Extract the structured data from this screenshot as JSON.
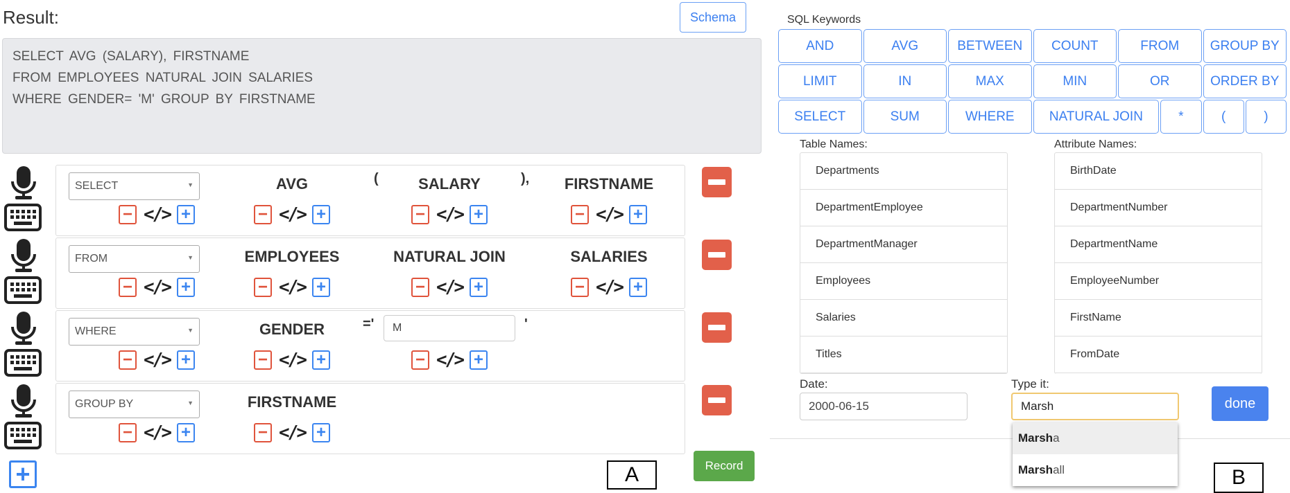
{
  "panel_a": {
    "result_label": "Result:",
    "schema_button": "Schema",
    "result_lines": [
      "SELECT  AVG  (SALARY),  FIRSTNAME",
      "FROM  EMPLOYEES  NATURAL JOIN  SALARIES",
      "WHERE  GENDER=  'M'  GROUP BY  FIRSTNAME"
    ],
    "rows": [
      {
        "clause": "SELECT",
        "tokens": [
          "AVG",
          "SALARY",
          "FIRSTNAME"
        ],
        "punct": [
          "(",
          "),"
        ]
      },
      {
        "clause": "FROM",
        "tokens": [
          "EMPLOYEES",
          "NATURAL JOIN",
          "SALARIES"
        ]
      },
      {
        "clause": "WHERE",
        "tokens": [
          "GENDER"
        ],
        "operator": "='",
        "value": "M",
        "close": "'"
      },
      {
        "clause": "GROUP BY",
        "tokens": [
          "FIRSTNAME"
        ]
      }
    ],
    "record_button": "Record",
    "panel_label": "A",
    "colors": {
      "remove": "#e2604a",
      "add": "#3b85f0",
      "record": "#5ba84a"
    }
  },
  "panel_b": {
    "keywords_label": "SQL Keywords",
    "keywords": [
      "AND",
      "AVG",
      "BETWEEN",
      "COUNT",
      "FROM",
      "GROUP BY",
      "LIMIT",
      "IN",
      "MAX",
      "MIN",
      "OR",
      "ORDER BY",
      "SELECT",
      "SUM",
      "WHERE",
      "NATURAL JOIN",
      "*",
      "(",
      ")"
    ],
    "table_names_label": "Table Names:",
    "table_names": [
      "Departments",
      "DepartmentEmployee",
      "DepartmentManager",
      "Employees",
      "Salaries",
      "Titles"
    ],
    "attribute_names_label": "Attribute Names:",
    "attribute_names": [
      "BirthDate",
      "DepartmentNumber",
      "DepartmentName",
      "EmployeeNumber",
      "FirstName",
      "FromDate"
    ],
    "date_label": "Date:",
    "date_value": "2000-06-15",
    "type_label": "Type it:",
    "type_value": "Marsh",
    "suggestions": [
      {
        "match": "Marsh",
        "rest": "a"
      },
      {
        "match": "Marsh",
        "rest": "all"
      }
    ],
    "done_button": "done",
    "panel_label": "B",
    "colors": {
      "accent": "#4a83ee"
    }
  }
}
